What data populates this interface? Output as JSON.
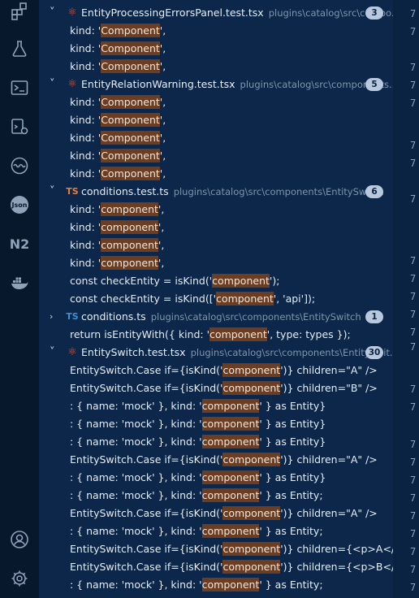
{
  "activity_bar": {
    "items": [
      {
        "name": "extensions-icon"
      },
      {
        "name": "testing-flask-icon"
      },
      {
        "name": "terminal-icon"
      },
      {
        "name": "remote-explorer-icon"
      },
      {
        "name": "ports-wave-icon"
      },
      {
        "name": "json-icon"
      },
      {
        "name": "n2-icon"
      },
      {
        "name": "docker-icon"
      }
    ],
    "bottom": [
      {
        "name": "account-icon"
      },
      {
        "name": "settings-gear-icon"
      }
    ]
  },
  "search_results": [
    {
      "type": "file",
      "name": "EntityProcessingErrorsPanel.test.tsx",
      "path": "plugins\\catalog\\src\\compo...",
      "count": "3",
      "icon": "react",
      "matches": [
        {
          "pre": "kind: '",
          "match": "Component",
          "post": "',"
        },
        {
          "pre": "kind: '",
          "match": "Component",
          "post": "',"
        },
        {
          "pre": "kind: '",
          "match": "Component",
          "post": "',"
        }
      ]
    },
    {
      "type": "file",
      "name": "EntityRelationWarning.test.tsx",
      "path": "plugins\\catalog\\src\\components...",
      "count": "5",
      "icon": "react",
      "matches": [
        {
          "pre": "kind: '",
          "match": "Component",
          "post": "',"
        },
        {
          "pre": "kind: '",
          "match": "Component",
          "post": "',"
        },
        {
          "pre": "kind: '",
          "match": "Component",
          "post": "',"
        },
        {
          "pre": "kind: '",
          "match": "Component",
          "post": "',"
        },
        {
          "pre": "kind: '",
          "match": "Component",
          "post": "',"
        }
      ]
    },
    {
      "type": "file",
      "name": "conditions.test.ts",
      "path": "plugins\\catalog\\src\\components\\EntitySwitch",
      "count": "6",
      "icon": "ts-test",
      "matches": [
        {
          "pre": "kind: '",
          "match": "component",
          "post": "',"
        },
        {
          "pre": "kind: '",
          "match": "component",
          "post": "',"
        },
        {
          "pre": "kind: '",
          "match": "component",
          "post": "',"
        },
        {
          "pre": "kind: '",
          "match": "component",
          "post": "',"
        },
        {
          "pre": "const checkEntity = isKind('",
          "match": "component",
          "post": "');"
        },
        {
          "pre": "const checkEntity = isKind(['",
          "match": "component",
          "post": "', 'api']);"
        }
      ]
    },
    {
      "type": "file",
      "name": "conditions.ts",
      "path": "plugins\\catalog\\src\\components\\EntitySwitch",
      "count": "1",
      "icon": "ts",
      "collapsed": true,
      "matches": [
        {
          "pre": "return isEntityWith({ kind: '",
          "match": "component",
          "post": "', type: types });"
        }
      ]
    },
    {
      "type": "file",
      "name": "EntitySwitch.test.tsx",
      "path": "plugins\\catalog\\src\\components\\EntitySwit...",
      "count": "30",
      "icon": "react",
      "matches": [
        {
          "pre": "EntitySwitch.Case if={isKind('",
          "match": "component",
          "post": "')} children=\"A\" />"
        },
        {
          "pre": "EntitySwitch.Case if={isKind('",
          "match": "component",
          "post": "')} children=\"B\" />"
        },
        {
          "pre": ": { name: 'mock' }, kind: '",
          "match": "component",
          "post": "' } as Entity}"
        },
        {
          "pre": ": { name: 'mock' }, kind: '",
          "match": "component",
          "post": "' } as Entity}"
        },
        {
          "pre": ": { name: 'mock' }, kind: '",
          "match": "component",
          "post": "' } as Entity}"
        },
        {
          "pre": "EntitySwitch.Case if={isKind('",
          "match": "component",
          "post": "')} children=\"A\" />"
        },
        {
          "pre": ": { name: 'mock' }, kind: '",
          "match": "component",
          "post": "' } as Entity}"
        },
        {
          "pre": ": { name: 'mock' }, kind: '",
          "match": "component",
          "post": "' } as Entity;"
        },
        {
          "pre": "EntitySwitch.Case if={isKind('",
          "match": "component",
          "post": "')} children=\"A\" />"
        },
        {
          "pre": ": { name: 'mock' }, kind: '",
          "match": "component",
          "post": "' } as Entity;"
        },
        {
          "pre": "EntitySwitch.Case if={isKind('",
          "match": "component",
          "post": "')} children={<p>A</p>} />"
        },
        {
          "pre": "EntitySwitch.Case if={isKind('",
          "match": "component",
          "post": "')} children={<p>B</p>} />"
        },
        {
          "pre": ": { name: 'mock' }, kind: '",
          "match": "component",
          "post": "' } as Entity;"
        }
      ]
    }
  ],
  "editor_line_numbers": [
    "7",
    "7",
    "7",
    "7",
    "7",
    "7",
    "7",
    "7",
    "7",
    "7",
    "7",
    "7",
    "7",
    "7",
    "7",
    "7",
    "7",
    "7",
    "7",
    "7",
    "7",
    "7",
    "7",
    "7",
    "7",
    "7",
    "7",
    "7"
  ]
}
